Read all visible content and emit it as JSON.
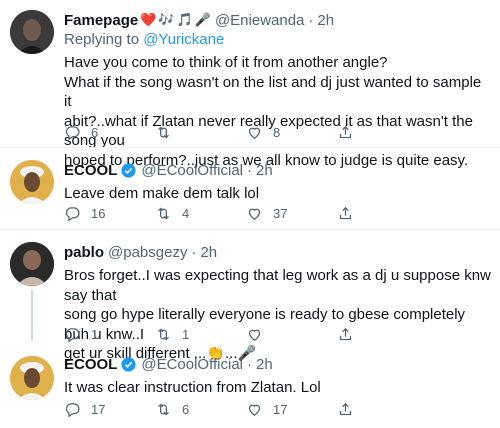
{
  "tweets": [
    {
      "name": "Famepage",
      "emojis": [
        "❤️",
        "🎶",
        "🎵",
        "🎤"
      ],
      "handle": "@Eniewanda",
      "time": "2h",
      "verified": false,
      "reply_prefix": "Replying to",
      "reply_to": "@Yurickane",
      "lines": [
        "Have you come to think of it from another angle?",
        "What if the song wasn't on the list and dj just wanted to sample it",
        "abit?..what if Zlatan never really expected it as that wasn't the song you",
        "hoped to perform?..just as we all know to judge is quite easy."
      ],
      "replies": "6",
      "retweets": "",
      "likes": "8"
    },
    {
      "name": "ECOOL",
      "emojis": [],
      "handle": "@ECoolOfficial",
      "time": "2h",
      "verified": true,
      "lines": [
        "Leave dem make dem talk lol"
      ],
      "replies": "16",
      "retweets": "4",
      "likes": "37"
    },
    {
      "name": "pablo",
      "emojis": [],
      "handle": "@pabsgezy",
      "time": "2h",
      "verified": false,
      "lines": [
        "Bros forget..I was expecting that leg work as a dj u suppose knw say that",
        "song go hype literally everyone is ready to gbese completely buh u knw..I",
        "get ur skill different ...👏...🎤"
      ],
      "replies": "1",
      "retweets": "1",
      "likes": ""
    },
    {
      "name": "ECOOL",
      "emojis": [],
      "handle": "@ECoolOfficial",
      "time": "2h",
      "verified": true,
      "lines": [
        "It was clear instruction from Zlatan. Lol"
      ],
      "replies": "17",
      "retweets": "6",
      "likes": "17"
    }
  ],
  "icons": {
    "reply": "reply-icon",
    "retweet": "retweet-icon",
    "like": "like-icon",
    "share": "share-icon",
    "verified": "verified-badge-icon"
  },
  "colors": {
    "accent": "#1d9bf0",
    "secondary_text": "#536471",
    "divider": "#eff3f4"
  }
}
